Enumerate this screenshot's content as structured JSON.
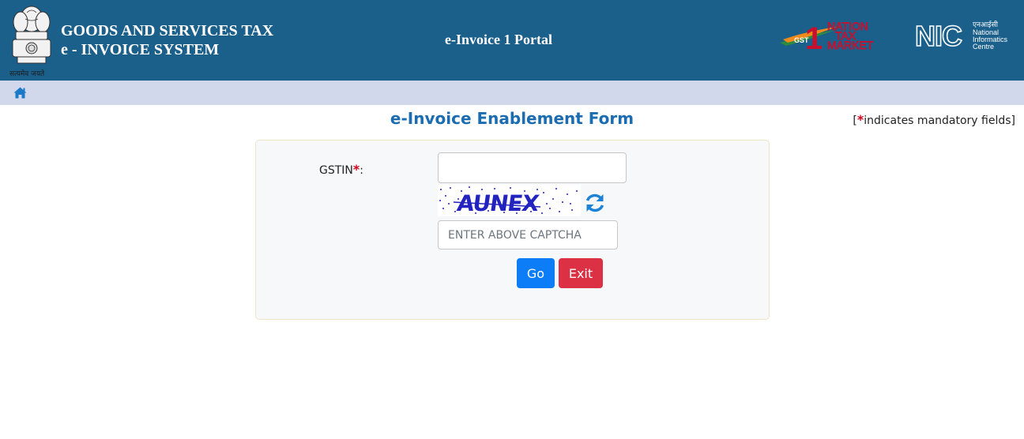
{
  "header": {
    "brand_line1": "GOODS AND SERVICES TAX",
    "brand_line2": "e - INVOICE SYSTEM",
    "emblem_motto": "सत्यमेव जयते",
    "portal_title": "e-Invoice 1 Portal",
    "logo_left": {
      "line1": "NATION",
      "line2": "TAX",
      "line3": "MARKET",
      "badge": "GST",
      "numeral": "1"
    },
    "logo_right": {
      "mark": "NIC",
      "hindi": "एनआईसी",
      "line1": "National",
      "line2": "Informatics",
      "line3": "Centre"
    }
  },
  "nav": {
    "home_icon": "home-icon"
  },
  "form": {
    "title": "e-Invoice Enablement Form",
    "mandatory_note_star": "*",
    "mandatory_note_text": "indicates mandatory fields]",
    "mandatory_note_open": "[",
    "gstin_label": "GSTIN",
    "gstin_required": "*",
    "gstin_colon": ":",
    "gstin_value": "",
    "captcha_text": "AUNEX",
    "captcha_placeholder": "ENTER ABOVE CAPTCHA",
    "captcha_value": "",
    "go_label": "Go",
    "exit_label": "Exit"
  },
  "colors": {
    "header_bg": "#1b5f8b",
    "nav_bg": "#d2d8ec",
    "title": "#1b6cb0",
    "go_button": "#0d7df7",
    "exit_button": "#dc3045",
    "required_star": "#d0021b"
  }
}
